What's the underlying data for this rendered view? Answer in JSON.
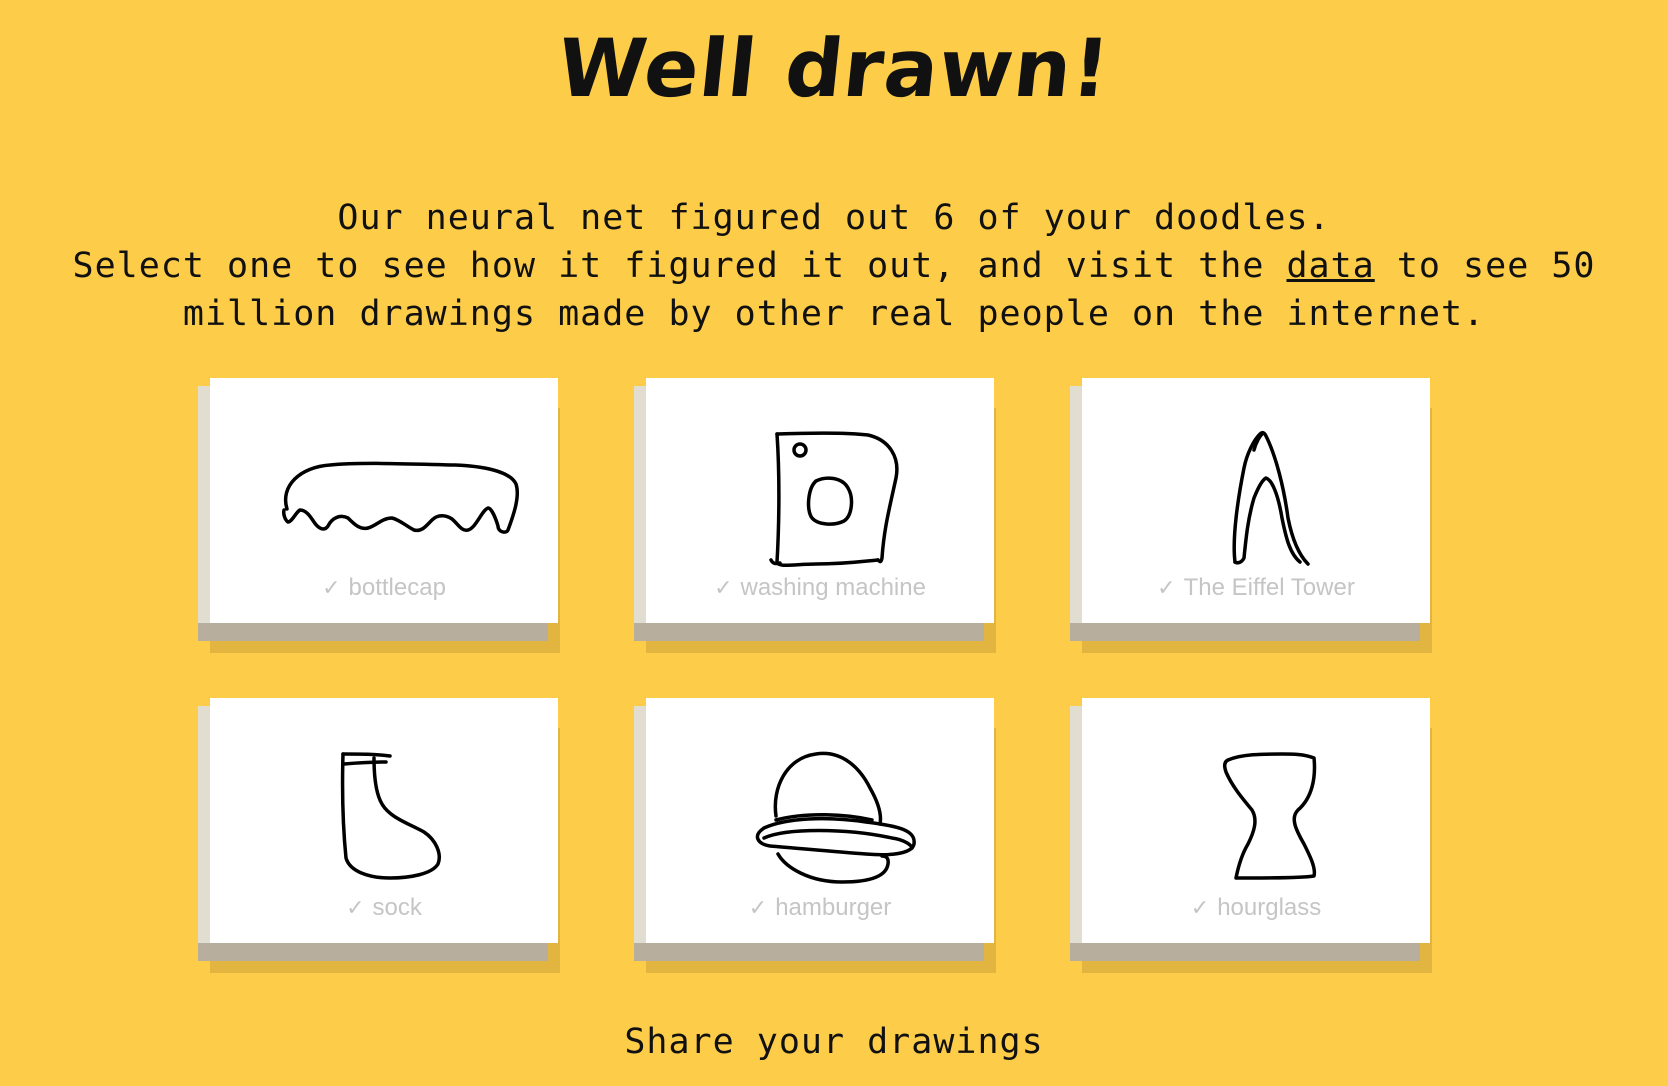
{
  "title": "Well drawn!",
  "message": {
    "line1": "Our neural net figured out 6 of your doodles.",
    "line2_before": "Select one to see how it figured it out, and visit the ",
    "line2_link": "data",
    "line2_after": " to see 50",
    "line3": "million drawings made by other real people on the internet."
  },
  "cards": [
    {
      "label": "bottlecap",
      "icon": "bottlecap-doodle"
    },
    {
      "label": "washing machine",
      "icon": "washing-machine-doodle"
    },
    {
      "label": "The Eiffel Tower",
      "icon": "eiffel-tower-doodle"
    },
    {
      "label": "sock",
      "icon": "sock-doodle"
    },
    {
      "label": "hamburger",
      "icon": "hamburger-doodle"
    },
    {
      "label": "hourglass",
      "icon": "hourglass-doodle"
    }
  ],
  "check_glyph": "✓",
  "share": "Share your drawings",
  "colors": {
    "background": "#fdcd4a",
    "card": "#ffffff",
    "label": "#c5c5c5",
    "ink": "#111111"
  }
}
